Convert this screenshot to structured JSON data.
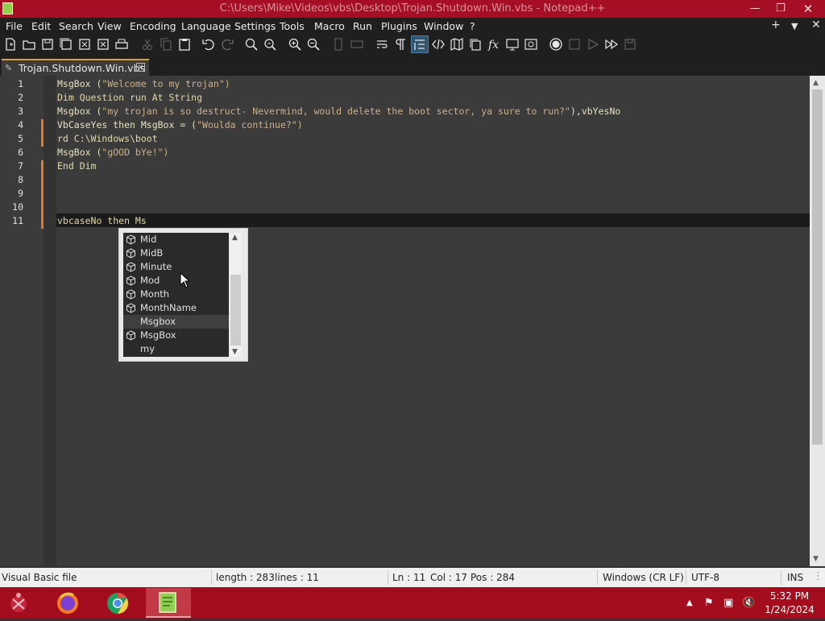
{
  "window": {
    "title": "C:\\Users\\Mike\\Videos\\vbs\\Desktop\\Trojan.Shutdown.Win.vbs - Notepad++",
    "accent_color": "#a50e25"
  },
  "menu": {
    "items": [
      "File",
      "Edit",
      "Search",
      "View",
      "Encoding",
      "Language",
      "Settings",
      "Tools",
      "Macro",
      "Run",
      "Plugins",
      "Window",
      "?"
    ],
    "right_icons": [
      "plus-icon",
      "chevron-down-icon",
      "close-icon"
    ]
  },
  "toolbar": {
    "icons": [
      "new-file-icon",
      "open-file-icon",
      "save-icon",
      "save-all-icon",
      "close-icon",
      "close-all-icon",
      "print-icon",
      "cut-icon",
      "copy-icon",
      "paste-icon",
      "undo-icon",
      "redo-icon",
      "find-icon",
      "replace-icon",
      "zoom-in-icon",
      "zoom-out-icon",
      "sync-vertical-icon",
      "sync-horizontal-icon",
      "word-wrap-icon",
      "show-all-chars-icon",
      "indent-guide-icon",
      "xml-tag-icon",
      "document-map-icon",
      "document-list-icon",
      "function-list-icon",
      "folder-workspace-icon",
      "monitoring-icon",
      "record-macro-icon",
      "stop-recording-icon",
      "play-macro-icon",
      "run-macro-multiple-icon",
      "save-macro-icon"
    ]
  },
  "tab": {
    "label": "Trojan.Shutdown.Win.vbs"
  },
  "editor": {
    "line_numbers": [
      "1",
      "2",
      "3",
      "4",
      "5",
      "6",
      "7",
      "8",
      "9",
      "10",
      "11"
    ],
    "lines": [
      "MsgBox (\"Welcome to my trojan\")",
      "Dim Question run At String",
      "Msgbox (\"my trojan is so destruct- Nevermind, would delete the boot sector, ya sure to run?\"),vbYesNo",
      "VbCaseYes then MsgBox = (\"Woulda continue?\")",
      "rd C:\\Windows\\boot",
      "MsgBox (\"gOOD bYe!\")",
      "End Dim",
      "",
      "",
      "",
      "vbcaseNo then Ms"
    ],
    "current_line": 11
  },
  "autocomplete": {
    "items": [
      {
        "label": "Mid",
        "icon": "function-cube-icon"
      },
      {
        "label": "MidB",
        "icon": "function-cube-icon"
      },
      {
        "label": "Minute",
        "icon": "function-cube-icon"
      },
      {
        "label": "Mod",
        "icon": "function-cube-icon"
      },
      {
        "label": "Month",
        "icon": "function-cube-icon"
      },
      {
        "label": "MonthName",
        "icon": "function-cube-icon"
      },
      {
        "label": "Msgbox",
        "icon": ""
      },
      {
        "label": "MsgBox",
        "icon": "function-cube-icon"
      },
      {
        "label": "my",
        "icon": ""
      }
    ],
    "selected_index": 6
  },
  "status": {
    "language": "Visual Basic file",
    "length": "length : 283",
    "lines": "lines : 11",
    "ln": "Ln : 11",
    "col": "Col : 17",
    "pos": "Pos : 284",
    "eol": "Windows (CR LF)",
    "encoding": "UTF-8",
    "mode": "INS"
  },
  "taskbar": {
    "apps": [
      "start-icon",
      "firefox-icon",
      "chrome-icon",
      "notepadpp-icon"
    ],
    "active_app": "notepadpp-icon",
    "tray_icons": [
      "tray-overflow-icon",
      "flag-icon",
      "network-icon",
      "volume-muted-icon"
    ],
    "time": "5:32 PM",
    "date": "1/24/2024"
  }
}
